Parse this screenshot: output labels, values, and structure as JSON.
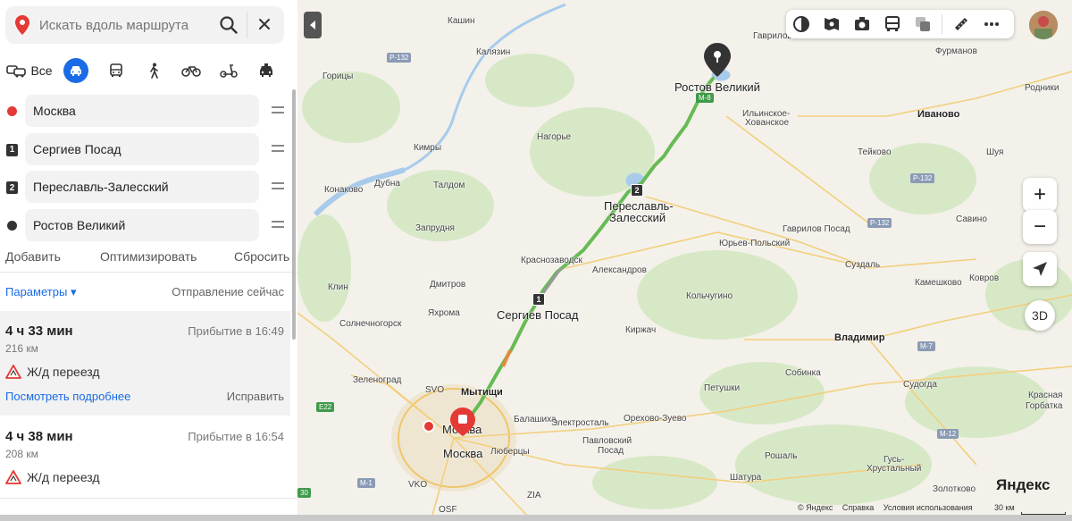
{
  "search": {
    "placeholder": "Искать вдоль маршрута"
  },
  "modes": {
    "all_label": "Все"
  },
  "points": [
    {
      "label": "Москва",
      "marker": ""
    },
    {
      "label": "Сергиев Посад",
      "marker": "1"
    },
    {
      "label": "Переславль-Залесский",
      "marker": "2"
    },
    {
      "label": "Ростов Великий",
      "marker": ""
    }
  ],
  "actions": {
    "add": "Добавить",
    "optimize": "Оптимизировать",
    "reset": "Сбросить"
  },
  "params": {
    "link": "Параметры",
    "arrow": "▾",
    "departure": "Отправление сейчас"
  },
  "routes": [
    {
      "duration": "4 ч 33 мин",
      "arrival": "Прибытие в 16:49",
      "distance": "216 км",
      "warning": "Ж/д переезд",
      "details": "Посмотреть подробнее",
      "fix": "Исправить"
    },
    {
      "duration": "4 ч 38 мин",
      "arrival": "Прибытие в 16:54",
      "distance": "208 км",
      "warning": "Ж/д переезд"
    }
  ],
  "map": {
    "cities": [
      {
        "name": "Ростов Великий",
        "cls": "city"
      },
      {
        "name": "Переславль-",
        "cls": "city"
      },
      {
        "name": "Залесский",
        "cls": "city"
      },
      {
        "name": "Сергиев Посад",
        "cls": "city"
      },
      {
        "name": "Москва",
        "cls": "city"
      },
      {
        "name": "Москва",
        "cls": "city"
      }
    ],
    "places": [
      "Кашин",
      "Калязин",
      "Горицы",
      "Кимры",
      "Нагорье",
      "Дубна",
      "Талдом",
      "Конаково",
      "Запрудня",
      "Краснозаводск",
      "Александров",
      "Клин",
      "Дмитров",
      "Яхрома",
      "Солнечногорск",
      "Киржач",
      "Кольчугино",
      "Юрьев-Польский",
      "Гаврилов Посад",
      "Ильинское-",
      "Хованское",
      "Тейково",
      "Шуя",
      "Савино",
      "Суздаль",
      "Камешково",
      "Ковров",
      "Зеленоград",
      "Балашиха",
      "Электросталь",
      "Орехово-Зуево",
      "Петушки",
      "Собинка",
      "Судогда",
      "Павловский",
      "Посад",
      "Люберцы",
      "Шатура",
      "Рошаль",
      "Гусь-",
      "Хрустальный",
      "Золотково",
      "Гаврилов",
      "Фурманов",
      "Родники",
      "Красная",
      "Горбатка"
    ],
    "bold_places": [
      "Иваново",
      "Владимир",
      "Мытищи"
    ],
    "shields": [
      "Р-132",
      "М-8",
      "Р-132",
      "Р-132",
      "М-7",
      "М-12",
      "Е22",
      "М-1",
      "30"
    ],
    "airports": [
      "SVO",
      "VKO",
      "ZIA",
      "OSF"
    ],
    "collapse_icon": "chevron-left-icon",
    "zoom_in": "+",
    "zoom_out": "−",
    "btn_3d": "3D",
    "logo_main": "Яндекс",
    "copyright": [
      "© Яндекс",
      "Справка",
      "Условия использования"
    ],
    "scale": "30 км"
  },
  "colors": {
    "accent": "#1a6be5",
    "route": "#66bb55",
    "start": "#e53935"
  }
}
